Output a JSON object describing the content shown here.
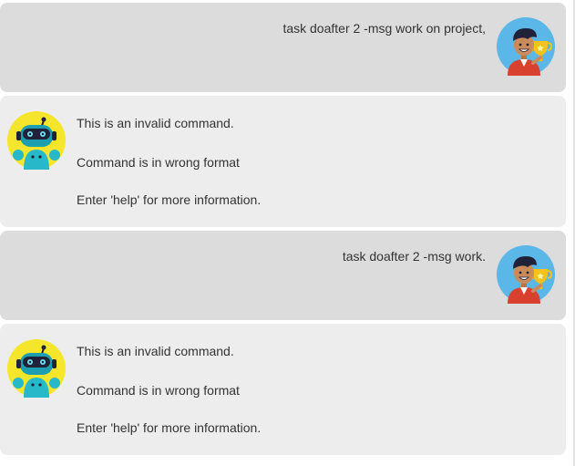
{
  "messages": [
    {
      "role": "user",
      "text": "task doafter 2 -msg work on project,",
      "avatar_icon": "user-avatar-icon"
    },
    {
      "role": "bot",
      "lines": [
        "This is an invalid command.",
        "Command is in wrong format",
        "Enter 'help' for more information."
      ],
      "avatar_icon": "robot-avatar-icon"
    },
    {
      "role": "user",
      "text": "task doafter 2 -msg work.",
      "avatar_icon": "user-avatar-icon"
    },
    {
      "role": "bot",
      "lines": [
        "This is an invalid command.",
        "Command is in wrong format",
        "Enter 'help' for more information."
      ],
      "avatar_icon": "robot-avatar-icon"
    }
  ],
  "colors": {
    "user_bubble": "#dcdcdc",
    "bot_bubble": "#ededed",
    "text": "#333333",
    "avatar_bg_user": "#5bb7e8",
    "avatar_bg_bot": "#f5e62c",
    "robot_body": "#27b8c9"
  }
}
